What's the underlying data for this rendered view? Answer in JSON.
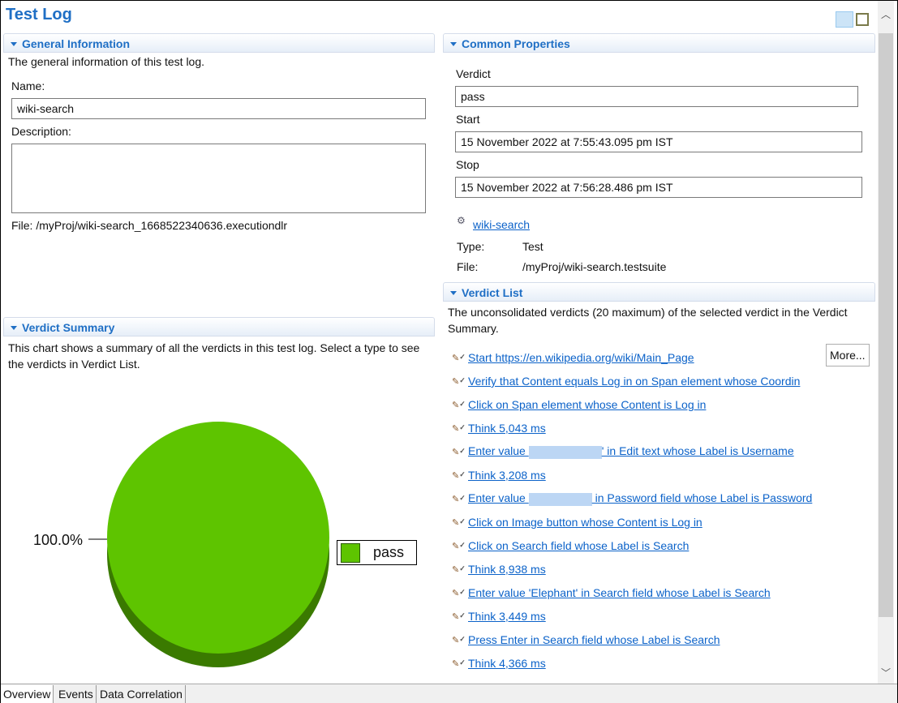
{
  "title": "Test Log",
  "general": {
    "header": "General Information",
    "desc": "The general information of this test log.",
    "name_label": "Name:",
    "name_value": "wiki-search",
    "description_label": "Description:",
    "description_value": "",
    "file": "File:  /myProj/wiki-search_1668522340636.executiondlr"
  },
  "common": {
    "header": "Common Properties",
    "verdict_label": "Verdict",
    "verdict": "pass",
    "start_label": "Start",
    "start": "15 November 2022 at 7:55:43.095 pm IST",
    "stop_label": "Stop",
    "stop": "15 November 2022 at 7:56:28.486 pm IST",
    "link": "wiki-search",
    "type_label": "Type:",
    "type": "Test",
    "file_label": "File:",
    "file": "/myProj/wiki-search.testsuite"
  },
  "summary": {
    "header": "Verdict Summary",
    "desc": "This chart shows a summary of all the verdicts in this test log. Select a type to see the verdicts in Verdict List.",
    "percent_label": "100.0%",
    "legend": "pass"
  },
  "chart_data": {
    "type": "pie",
    "categories": [
      "pass"
    ],
    "values": [
      100
    ],
    "colors": [
      "#5ec400"
    ],
    "legend_position": "right"
  },
  "verdict_list": {
    "header": "Verdict List",
    "desc": "The unconsolidated verdicts (20 maximum) of the selected verdict in the Verdict Summary.",
    "more": "More...",
    "items": [
      {
        "text": "Start https://en.wikipedia.org/wiki/Main_Page"
      },
      {
        "text": "Verify that Content equals Log in on Span element whose Coordin"
      },
      {
        "text": "Click on Span element whose Content is Log in"
      },
      {
        "text": "Think 5,043 ms"
      },
      {
        "pre": "Enter value ",
        "post": "' in Edit text whose Label is Username",
        "blur": true
      },
      {
        "text": "Think 3,208 ms"
      },
      {
        "pre": "Enter value ",
        "post": " in Password field whose Label is Password",
        "blur": true
      },
      {
        "text": "Click on Image button whose Content is Log in"
      },
      {
        "text": "Click on Search field whose Label is Search"
      },
      {
        "text": "Think 8,938 ms"
      },
      {
        "text": "Enter value 'Elephant' in Search field whose Label is Search"
      },
      {
        "text": "Think 3,449 ms"
      },
      {
        "text": "Press Enter in Search field whose Label is Search"
      },
      {
        "text": "Think 4,366 ms"
      }
    ]
  },
  "tabs": [
    "Overview",
    "Events",
    "Data Correlation"
  ]
}
